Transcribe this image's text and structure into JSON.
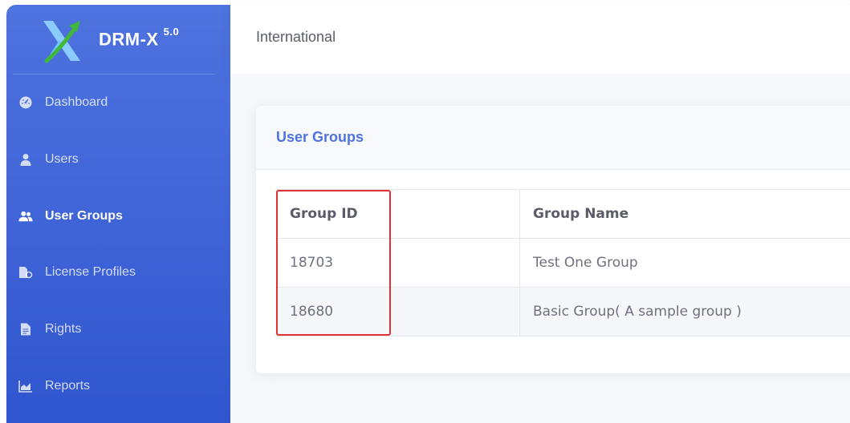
{
  "brand": {
    "name": "DRM-X",
    "version": "5.0",
    "logo_icon": "x-arrow-logo-icon"
  },
  "sidebar": {
    "items": [
      {
        "label": "Dashboard",
        "icon": "dashboard-gauge-icon",
        "active": false
      },
      {
        "label": "Users",
        "icon": "user-icon",
        "active": false
      },
      {
        "label": "User Groups",
        "icon": "users-group-icon",
        "active": true
      },
      {
        "label": "License Profiles",
        "icon": "license-file-icon",
        "active": false
      },
      {
        "label": "Rights",
        "icon": "document-icon",
        "active": false
      },
      {
        "label": "Reports",
        "icon": "area-chart-icon",
        "active": false
      }
    ]
  },
  "topbar": {
    "title": "International"
  },
  "card": {
    "title": "User Groups"
  },
  "table": {
    "headers": [
      "Group ID",
      "Group Name"
    ],
    "rows": [
      [
        "18703",
        "Test One Group"
      ],
      [
        "18680",
        "Basic Group( A sample group )"
      ]
    ]
  },
  "colors": {
    "sidebar_primary": "#4e73df",
    "accent": "#4e73df",
    "highlight": "#e0302f"
  }
}
